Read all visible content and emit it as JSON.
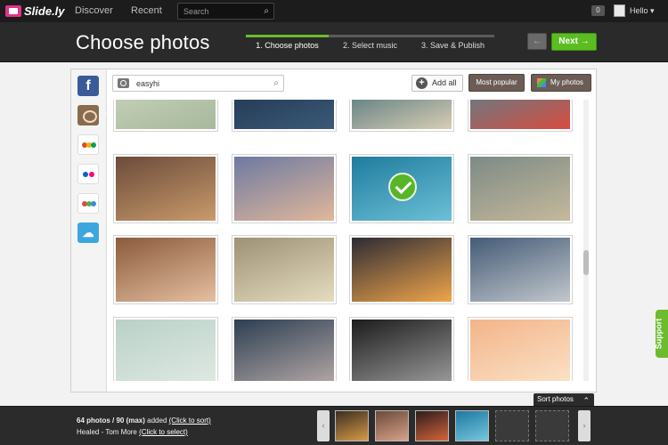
{
  "app": {
    "logo": "Slide.ly"
  },
  "topnav": {
    "links": [
      "Discover",
      "Recent"
    ],
    "search_placeholder": "Search",
    "message_count": "0",
    "greeting": "Hello ▾"
  },
  "header": {
    "title": "Choose photos",
    "steps": [
      {
        "label": "1. Choose photos",
        "active": true
      },
      {
        "label": "2. Select music",
        "active": false
      },
      {
        "label": "3. Save & Publish",
        "active": false
      }
    ],
    "back_label": "←",
    "next_label": "Next →"
  },
  "sources": [
    {
      "name": "facebook-icon",
      "glyph": "f",
      "active": false
    },
    {
      "name": "instagram-icon",
      "glyph": "",
      "active": true
    },
    {
      "name": "google-icon",
      "glyph": "",
      "active": false
    },
    {
      "name": "flickr-icon",
      "glyph": "",
      "active": false
    },
    {
      "name": "picasa-icon",
      "glyph": "",
      "active": false
    },
    {
      "name": "cloud-icon",
      "glyph": "☁",
      "active": false
    }
  ],
  "toolbar": {
    "album_search_value": "easyhi",
    "add_all_label": "Add all",
    "most_popular_label": "Most popular",
    "my_photos_label": "My photos"
  },
  "photos": [
    {
      "desc": "birds over water",
      "colors": [
        "#cfd9c2",
        "#a7b89b"
      ],
      "selected": false
    },
    {
      "desc": "dark blue scene",
      "colors": [
        "#1c2e45",
        "#3a5a78"
      ],
      "selected": false
    },
    {
      "desc": "swans",
      "colors": [
        "#2f5f6f",
        "#d8cdb4"
      ],
      "selected": false
    },
    {
      "desc": "clown face",
      "colors": [
        "#3a8ea0",
        "#d94b3f"
      ],
      "selected": false
    },
    {
      "desc": "man with guitar",
      "colors": [
        "#6b4b3a",
        "#c99a6b"
      ],
      "selected": false
    },
    {
      "desc": "family with baby",
      "colors": [
        "#6d7aa2",
        "#e1b79a"
      ],
      "selected": false
    },
    {
      "desc": "seagulls over sea",
      "colors": [
        "#1f7c9e",
        "#6cc0d6"
      ],
      "selected": true
    },
    {
      "desc": "child and pigeons",
      "colors": [
        "#7d8a86",
        "#c5b99b"
      ],
      "selected": false
    },
    {
      "desc": "smiling women",
      "colors": [
        "#8b5a3b",
        "#e4c0a1"
      ],
      "selected": false
    },
    {
      "desc": "woman face",
      "colors": [
        "#9e9175",
        "#e5dcc0"
      ],
      "selected": false
    },
    {
      "desc": "sunset silhouette",
      "colors": [
        "#2d2b35",
        "#f0a54a"
      ],
      "selected": false
    },
    {
      "desc": "street musician",
      "colors": [
        "#445b77",
        "#c2c7cc"
      ],
      "selected": false
    },
    {
      "desc": "flying heron",
      "colors": [
        "#b9d1c8",
        "#dfe9e2"
      ],
      "selected": false
    },
    {
      "desc": "flowers on stone",
      "colors": [
        "#2d3f52",
        "#b2a6a5"
      ],
      "selected": false
    },
    {
      "desc": "kids playing bw",
      "colors": [
        "#1c1c1c",
        "#9a9a9a"
      ],
      "selected": false
    },
    {
      "desc": "child lifted sunset",
      "colors": [
        "#f3b48a",
        "#fbe2c6"
      ],
      "selected": false
    }
  ],
  "footer": {
    "sort_label": "Sort photos",
    "count_text": "64 photos / 90 (max)",
    "added_text": " added ",
    "click_to_sort": "(Click to sort)",
    "music_text": "Healed - Tom More ",
    "click_to_select": "(Click to select)",
    "strip": [
      {
        "colors": [
          "#3b2e22",
          "#d69b45"
        ]
      },
      {
        "colors": [
          "#6b4a3a",
          "#d9a28a"
        ]
      },
      {
        "colors": [
          "#2c1d1c",
          "#d5643a"
        ]
      },
      {
        "colors": [
          "#1d78a1",
          "#77c7dd"
        ]
      }
    ],
    "empty_slots": 2,
    "prev_label": "‹",
    "next_label": "›"
  },
  "support_label": "Support"
}
